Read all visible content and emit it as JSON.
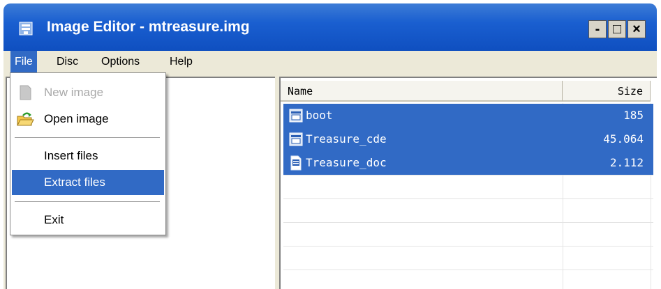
{
  "window": {
    "title": "Image Editor - mtreasure.img",
    "controls": {
      "minimize": "-",
      "maximize": "□",
      "close": "×"
    }
  },
  "menubar": {
    "items": [
      {
        "label": "File",
        "active": true
      },
      {
        "label": "Disc",
        "active": false
      },
      {
        "label": "Options",
        "active": false
      },
      {
        "label": "Help",
        "active": false
      }
    ]
  },
  "file_menu": {
    "items": [
      {
        "label": "New image",
        "icon": "new-image-icon",
        "enabled": false
      },
      {
        "label": "Open image",
        "icon": "open-folder-icon",
        "enabled": true
      },
      {
        "label": "Insert files",
        "enabled": true
      },
      {
        "label": "Extract files",
        "enabled": true,
        "highlighted": true
      },
      {
        "label": "Exit",
        "enabled": true
      }
    ]
  },
  "file_list": {
    "columns": [
      "Name",
      "Size"
    ],
    "rows": [
      {
        "name": "boot",
        "size": "185",
        "icon": "executable-file-icon",
        "selected": true
      },
      {
        "name": "Treasure_cde",
        "size": "45.064",
        "icon": "executable-file-icon",
        "selected": true
      },
      {
        "name": "Treasure_doc",
        "size": "2.112",
        "icon": "document-file-icon",
        "selected": true
      }
    ]
  },
  "colors": {
    "titlebar": "#1a5fd0",
    "selection": "#316ac5",
    "menubar": "#ece9d8"
  }
}
